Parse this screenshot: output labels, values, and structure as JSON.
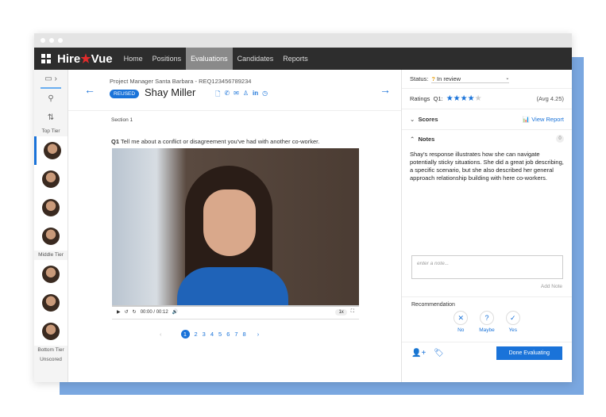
{
  "nav": {
    "logo_a": "Hire",
    "logo_b": "Vue",
    "items": [
      "Home",
      "Positions",
      "Evaluations",
      "Candidates",
      "Reports"
    ],
    "active": "Evaluations"
  },
  "sidebar": {
    "tiers": [
      "Top Tier",
      "Middle Tier",
      "Bottom Tier",
      "Unscored"
    ]
  },
  "header": {
    "requisition": "Project Manager Santa Barbara - REQ123456789234",
    "badge": "REUSED",
    "candidate": "Shay Miller"
  },
  "section": "Section 1",
  "question": {
    "num": "Q1",
    "text": "Tell me about a conflict or disagreement you've had with another co-worker."
  },
  "player": {
    "time": "00:00 / 00:12",
    "speed": "1x",
    "progress": 0
  },
  "pager": {
    "pages": [
      "1",
      "2",
      "3",
      "4",
      "5",
      "6",
      "7",
      "8"
    ],
    "current": "1"
  },
  "panel": {
    "status_label": "Status:",
    "status_value": "In review",
    "ratings_label": "Ratings",
    "ratings_q": "Q1:",
    "stars": 4,
    "avg": "(Avg 4.25)",
    "scores": "Scores",
    "view_report": "View Report",
    "notes": "Notes",
    "notes_count": "0",
    "note_text": "Shay's response illustrates how she can navigate potentially sticky situations. She did a great job describing, a specific scenario, but she also described her general approach relationship building with here co-workers.",
    "note_placeholder": "enter a note...",
    "add_note": "Add Note",
    "recommendation": "Recommendation",
    "rec_no": "No",
    "rec_maybe": "Maybe",
    "rec_yes": "Yes",
    "done": "Done Evaluating"
  },
  "colors": {
    "accent": "#1a73d9",
    "nav": "#2d2d2d",
    "logo_star": "#e02b2b"
  }
}
